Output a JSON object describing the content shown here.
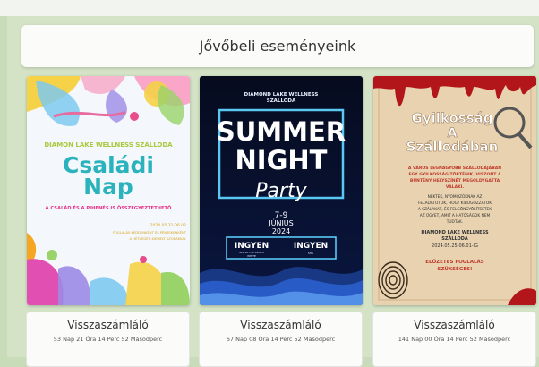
{
  "header": {
    "title": "Jővőbeli eseményeink"
  },
  "posters": [
    {
      "hotel": "DIAMON LAKE WELLNESS SZÁLLODA",
      "title_line1": "Családi",
      "title_line2": "Nap",
      "subtitle": "A CSALÁD ÉS A PIHENÉS IS ÖSSZEGYEZTETHETŐ",
      "date": "2024.05.31-06.02",
      "info_line1": "FOGLALÁS KEDDENKÉNT ÉS PÉNTEKENKÉNT",
      "info_line2": "A HÉTVÉGÉN KIEMELT SZOBÁKKAL"
    },
    {
      "hotel_line1": "DIAMOND LAKE WELLNESS",
      "hotel_line2": "SZÁLLODA",
      "title_line1": "SUMMER",
      "title_line2": "NIGHT",
      "script": "Party",
      "date_days": "7-9",
      "date_month": "JÚNIUS",
      "date_year": "2024",
      "free_left": "INGYEN",
      "free_right": "INGYEN",
      "free_left_note_1": "SEE IN THE BEACH",
      "free_left_note_2": "WHITE",
      "free_right_note": "SHA"
    },
    {
      "title_line1": "Gyilkosság",
      "title_line2": "A",
      "title_line3": "Szállodában",
      "text_line1": "A VÁROS LEGNAGYOBB SZÁLLODÁJÁBAN",
      "text_line2": "EGY GYILKOSSÁG TÖRTÉNIK, VISZONT A",
      "text_line3": "BŰNTÉNY HELYSZÍNÉT MEGOLDYGATTA",
      "text_line4": "VALAKI.",
      "text_line5": "NEKTEK, NYOMOZÓKNAK AZ",
      "text_line6": "FELADATOTOK, HOGY KIBOGOZZÁTOK",
      "text_line7": "A SZÁLAKAT, ÉS FELGÖNGYÖLÍTSETEK",
      "text_line8": "AZ ÜGYET, AMIT A HATÓSÁGOK NEM",
      "text_line9": "TUDTAK.",
      "hotel_line1": "DIAMOND LAKE WELLNESS",
      "hotel_line2": "SZÁLLODA",
      "date": "2024.05.25-06.01-IG",
      "booking_line1": "ELŐZETES FOGLALÁS",
      "booking_line2": "SZÜKSÉGES!"
    }
  ],
  "countdowns": [
    {
      "label": "Visszaszámláló",
      "text": "53 Nap 21 Óra 14 Perc 52 Másodperc"
    },
    {
      "label": "Visszaszámláló",
      "text": "67 Nap 08 Óra 14 Perc 52 Másodperc"
    },
    {
      "label": "Visszaszámláló",
      "text": "141 Nap 00 Óra 14 Perc 52 Másodperc"
    }
  ],
  "colors": {
    "page_bg": "#c9dcb9",
    "family_title": "#2bb3bd",
    "family_hotel": "#a8c93a",
    "neon_blue": "#5fd3ff",
    "murder_red": "#b3161a",
    "murder_paper": "#e8d2b0"
  }
}
